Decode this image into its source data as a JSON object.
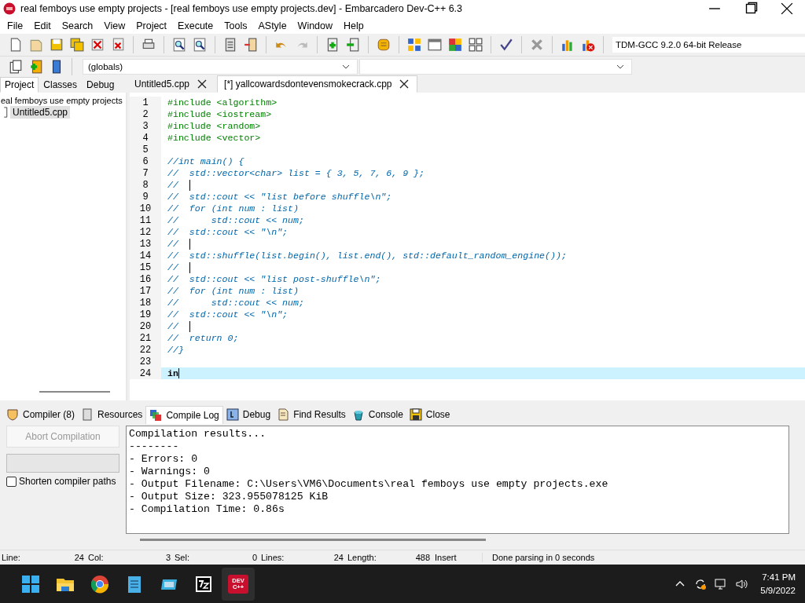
{
  "window": {
    "title": "real femboys use empty projects - [real femboys use empty projects.dev] - Embarcadero Dev-C++ 6.3"
  },
  "menu": [
    "File",
    "Edit",
    "Search",
    "View",
    "Project",
    "Execute",
    "Tools",
    "AStyle",
    "Window",
    "Help"
  ],
  "compiler_select": {
    "value": "TDM-GCC 9.2.0 64-bit Release"
  },
  "scope_select": {
    "value": "(globals)"
  },
  "side_tabs": [
    {
      "label": "Project",
      "selected": true
    },
    {
      "label": "Classes",
      "selected": false
    },
    {
      "label": "Debug",
      "selected": false
    }
  ],
  "project_tree": [
    {
      "label": "eal femboys use empty projects",
      "children": [
        {
          "label": "Untitled5.cpp",
          "selected": true
        }
      ]
    }
  ],
  "editor_tabs": [
    {
      "label": "Untitled5.cpp",
      "selected": false
    },
    {
      "label": "[*] yallcowardsdontevensmokecrack.cpp",
      "selected": true
    }
  ],
  "code_lines": [
    {
      "number": "1",
      "kind": "include",
      "text": "#include <algorithm>"
    },
    {
      "number": "2",
      "kind": "include",
      "text": "#include <iostream>"
    },
    {
      "number": "3",
      "kind": "include",
      "text": "#include <random>"
    },
    {
      "number": "4",
      "kind": "include",
      "text": "#include <vector>"
    },
    {
      "number": "5",
      "kind": "blank"
    },
    {
      "number": "6",
      "kind": "comment",
      "text": "//int main() {"
    },
    {
      "number": "7",
      "kind": "comment",
      "text": "//  std::vector<char> list = { 3, 5, 7, 6, 9 };"
    },
    {
      "number": "8",
      "kind": "comment",
      "text": "//",
      "guide": true
    },
    {
      "number": "9",
      "kind": "comment",
      "text": "//  std::cout << \"list before shuffle\\n\";"
    },
    {
      "number": "10",
      "kind": "comment",
      "text": "//  for (int num : list)"
    },
    {
      "number": "11",
      "kind": "comment",
      "text": "//      std::cout << num;"
    },
    {
      "number": "12",
      "kind": "comment",
      "text": "//  std::cout << \"\\n\";"
    },
    {
      "number": "13",
      "kind": "comment",
      "text": "//",
      "guide": true
    },
    {
      "number": "14",
      "kind": "comment",
      "text": "//  std::shuffle(list.begin(), list.end(), std::default_random_engine());"
    },
    {
      "number": "15",
      "kind": "comment",
      "text": "//",
      "guide": true
    },
    {
      "number": "16",
      "kind": "comment",
      "text": "//  std::cout << \"list post-shuffle\\n\";"
    },
    {
      "number": "17",
      "kind": "comment",
      "text": "//  for (int num : list)"
    },
    {
      "number": "18",
      "kind": "comment",
      "text": "//      std::cout << num;"
    },
    {
      "number": "19",
      "kind": "comment",
      "text": "//  std::cout << \"\\n\";"
    },
    {
      "number": "20",
      "kind": "comment",
      "text": "//",
      "guide": true
    },
    {
      "number": "21",
      "kind": "comment",
      "text": "//  return 0;"
    },
    {
      "number": "22",
      "kind": "comment",
      "text": "//}"
    },
    {
      "number": "23",
      "kind": "blank"
    },
    {
      "number": "24",
      "kind": "code",
      "text": "in",
      "current": true
    }
  ],
  "bottom_tabs": [
    {
      "label": "Compiler (8)",
      "selected": false
    },
    {
      "label": "Resources",
      "selected": false
    },
    {
      "label": "Compile Log",
      "selected": true
    },
    {
      "label": "Debug",
      "selected": false
    },
    {
      "label": "Find Results",
      "selected": false
    },
    {
      "label": "Console",
      "selected": false
    },
    {
      "label": "Close",
      "selected": false
    }
  ],
  "abort_button": {
    "label": "Abort Compilation",
    "disabled": true
  },
  "progress": {
    "level": 0
  },
  "shorten_paths": {
    "label": "Shorten compiler paths",
    "checked": false
  },
  "log_lines": [
    "Compilation results...",
    "--------",
    "- Errors: 0",
    "- Warnings: 0",
    "- Output Filename: C:\\Users\\VM6\\Documents\\real femboys use empty projects.exe",
    "- Output Size: 323.955078125 KiB",
    "- Compilation Time: 0.86s"
  ],
  "status_bar": {
    "fields": [
      {
        "label": "Line:",
        "value": "24"
      },
      {
        "label": "Col:",
        "value": "3"
      },
      {
        "label": "Sel:",
        "value": "0"
      },
      {
        "label": "Lines:",
        "value": "24"
      },
      {
        "label": "Length:",
        "value": "488"
      }
    ],
    "mode": "Insert",
    "message": "Done parsing in 0 seconds"
  },
  "taskbar": {
    "devcpp_label": "DEV C++",
    "time": "7:41 PM",
    "date": "5/9/2022"
  }
}
